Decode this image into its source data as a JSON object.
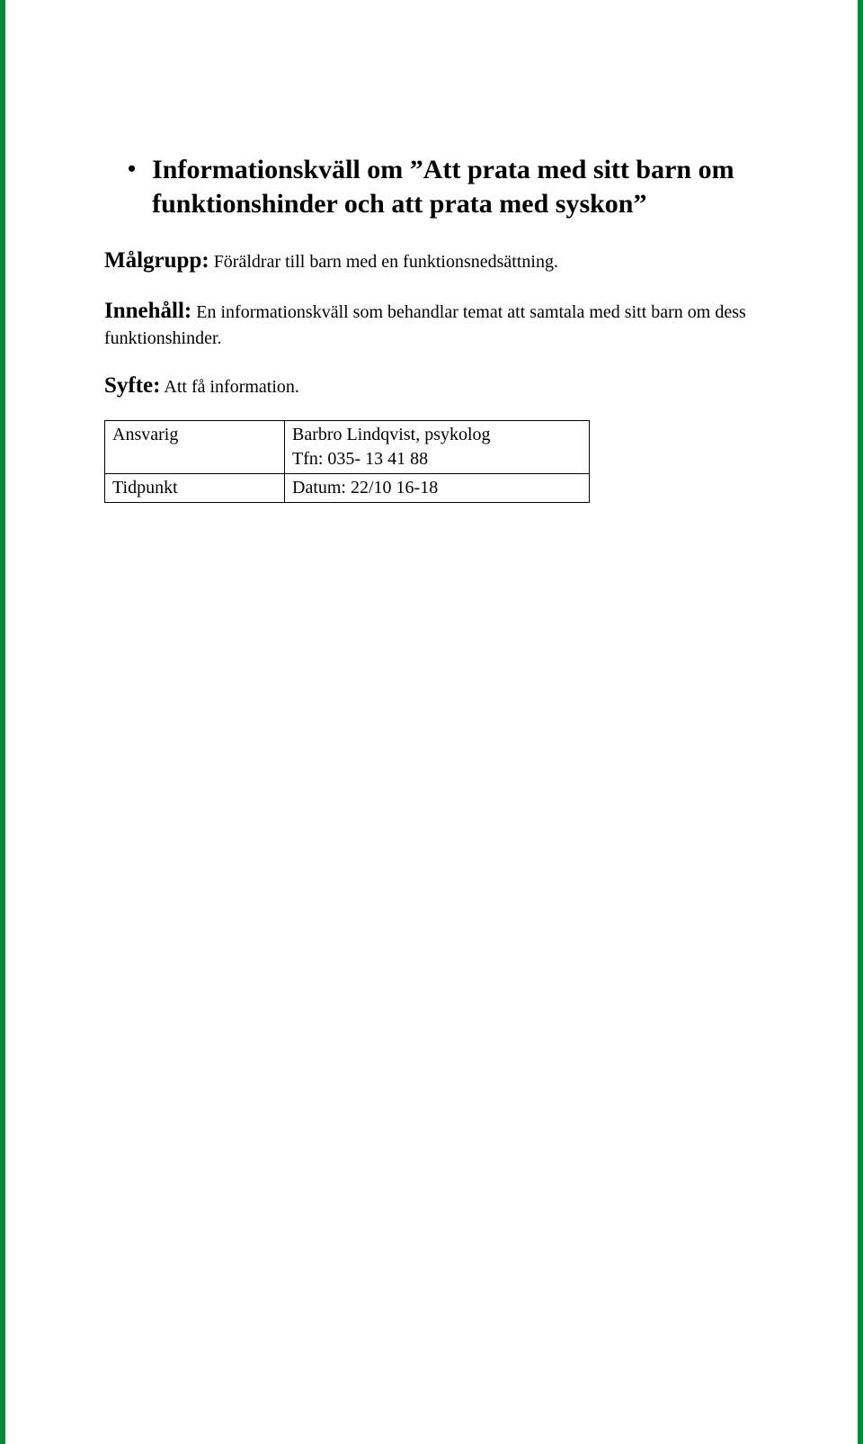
{
  "heading": "Informationskväll om ”Att prata med sitt barn om funktionshinder och att prata med syskon”",
  "sections": {
    "malgrupp": {
      "label": "Målgrupp:",
      "text": "Föräldrar till barn med en funktionsnedsättning."
    },
    "innehall": {
      "label": "Innehåll:",
      "text": "En informationskväll som behandlar temat att samtala med sitt barn om dess funktionshinder."
    },
    "syfte": {
      "label": "Syfte:",
      "text": "Att få information."
    }
  },
  "table": {
    "ansvarig": {
      "key": "Ansvarig",
      "name": "Barbro Lindqvist, psykolog",
      "phone": "Tfn: 035- 13 41 88"
    },
    "tidpunkt": {
      "key": "Tidpunkt",
      "value": "Datum: 22/10 16-18"
    }
  }
}
